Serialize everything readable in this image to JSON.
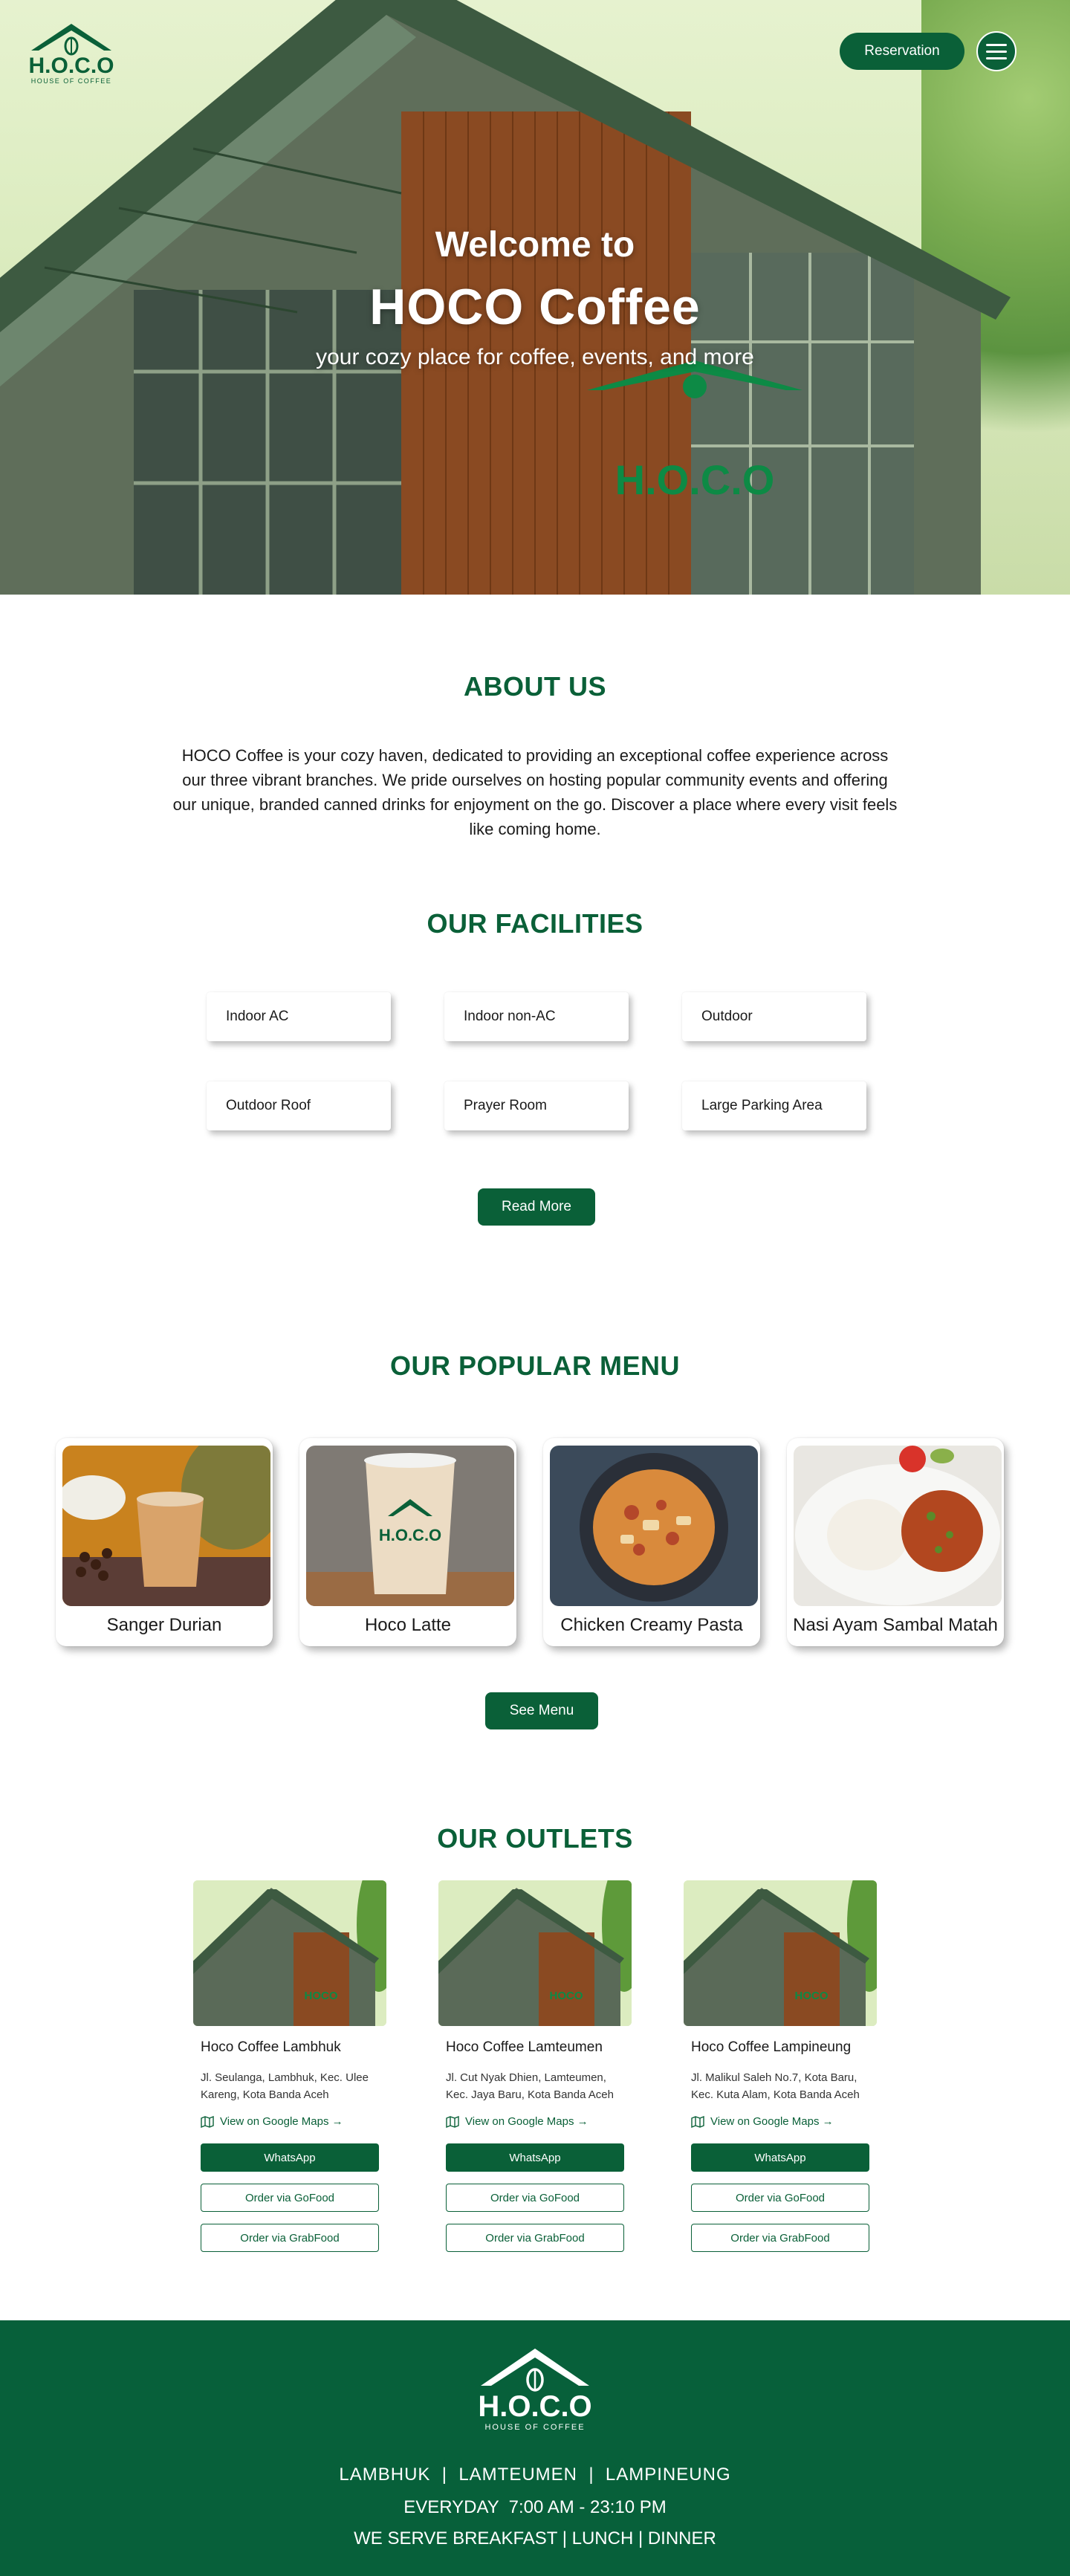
{
  "header": {
    "logo_text": "H.O.C.O",
    "logo_tagline": "HOUSE OF COFFEE",
    "reservation_label": "Reservation",
    "sign_text": "H.O.C.O"
  },
  "hero": {
    "welcome": "Welcome to",
    "title": "HOCO Coffee",
    "subtitle": "your cozy place for coffee, events, and more"
  },
  "about": {
    "title": "ABOUT US",
    "text": "HOCO Coffee is your cozy haven, dedicated to providing an exceptional coffee experience across our three vibrant branches. We pride ourselves on hosting popular community events and offering our unique, branded canned drinks for enjoyment on the go. Discover a place where every visit feels like coming home."
  },
  "facilities": {
    "title": "OUR FACILITIES",
    "items": [
      "Indoor AC",
      "Indoor non-AC",
      "Outdoor",
      "Outdoor Roof",
      "Prayer Room",
      "Large Parking Area"
    ],
    "button_label": "Read More"
  },
  "menu": {
    "title": "OUR POPULAR MENU",
    "items": [
      {
        "name": "Sanger Durian"
      },
      {
        "name": "Hoco Latte"
      },
      {
        "name": "Chicken Creamy Pasta"
      },
      {
        "name": "Nasi Ayam Sambal Matah"
      }
    ],
    "button_label": "See Menu"
  },
  "outlets": {
    "title": "OUR OUTLETS",
    "maps_label": "View on Google Maps →",
    "whatsapp_label": "WhatsApp",
    "gofood_label": "Order via GoFood",
    "grabfood_label": "Order via GrabFood",
    "items": [
      {
        "name": "Hoco Coffee Lambhuk",
        "address": "Jl. Seulanga, Lambhuk, Kec. Ulee Kareng, Kota Banda Aceh"
      },
      {
        "name": "Hoco Coffee Lamteumen",
        "address": "Jl. Cut Nyak Dhien, Lamteumen, Kec. Jaya Baru, Kota Banda Aceh"
      },
      {
        "name": "Hoco Coffee Lampineung",
        "address": "Jl. Malikul Saleh No.7, Kota Baru, Kec. Kuta Alam, Kota Banda Aceh"
      }
    ]
  },
  "footer": {
    "logo_text": "H.O.C.O",
    "logo_tagline": "HOUSE OF COFFEE",
    "branches": "LAMBHUK  |  LAMTEUMEN  |  LAMPINEUNG",
    "hours": "EVERYDAY  7:00 AM - 23:10 PM",
    "serves": "WE SERVE BREAKFAST | LUNCH | DINNER"
  },
  "colors": {
    "primary": "#0a6038",
    "footer": "#07603a"
  }
}
